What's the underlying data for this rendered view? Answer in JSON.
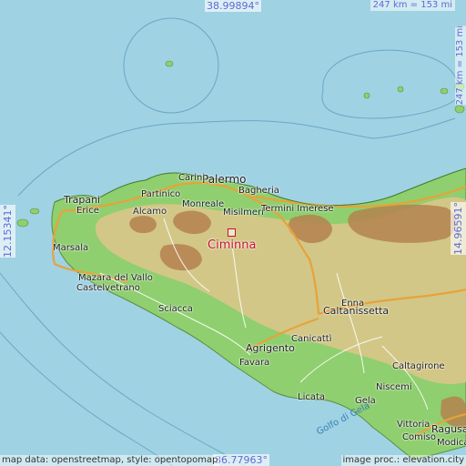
{
  "coords": {
    "top": "38.99894°",
    "bottom": "36.77963°",
    "left": "12.15341°",
    "right": "14.96591°"
  },
  "scale": {
    "top": "247 km = 153 mi",
    "right": "247 km = 153 mi"
  },
  "credits": {
    "left": "map data: openstreetmap, style: opentopomap",
    "right": "image proc.: elevation.city"
  },
  "main_place": "Ciminna",
  "towns": {
    "palermo": "Palermo",
    "carini": "Carini",
    "bagheria": "Bagheria",
    "trapani": "Trapani",
    "erice": "Erice",
    "partinico": "Partinico",
    "alcamo": "Alcamo",
    "monreale": "Monreale",
    "misilmeri": "Misilmeri",
    "termini": "Termini Imerese",
    "marsala": "Marsala",
    "mazara": "Mazara del Vallo",
    "castelvetrano": "Castelvetrano",
    "sciacca": "Sciacca",
    "agrigento": "Agrigento",
    "favara": "Favara",
    "canicatti": "Canicattì",
    "caltanissetta": "Caltanissetta",
    "enna": "Enna",
    "licata": "Licata",
    "gela": "Gela",
    "niscemi": "Niscemi",
    "caltagirone": "Caltagirone",
    "vittoria": "Vittoria",
    "ragusa": "Ragusa",
    "comiso": "Comiso",
    "modica": "Modica"
  },
  "sea_label": "Golfo di Gela",
  "colors": {
    "sea": "#9fd2e3",
    "lowland": "#8fcf6f",
    "hill": "#d9c58a",
    "mountain": "#b5824f",
    "road": "#e8a23a",
    "place": "#c8102e"
  }
}
